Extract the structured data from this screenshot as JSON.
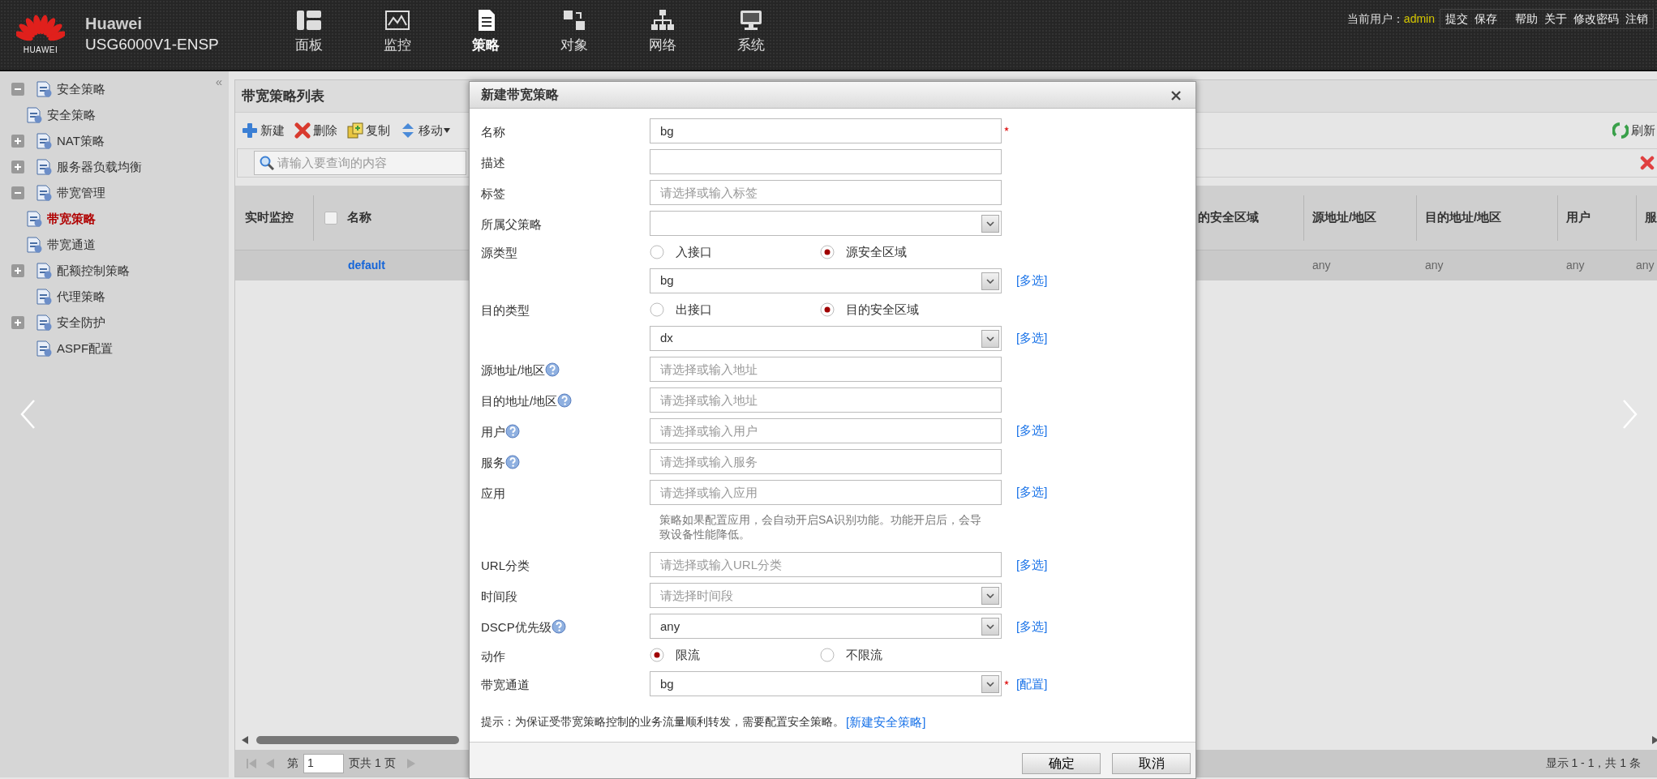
{
  "header": {
    "brand": {
      "logo_text": "HUAWEI",
      "name": "Huawei",
      "model": "USG6000V1-ENSP"
    },
    "nav": [
      {
        "label": "面板",
        "selected": false
      },
      {
        "label": "监控",
        "selected": false
      },
      {
        "label": "策略",
        "selected": true
      },
      {
        "label": "对象",
        "selected": false
      },
      {
        "label": "网络",
        "selected": false
      },
      {
        "label": "系统",
        "selected": false
      }
    ],
    "user_label": "当前用户：",
    "user": "admin",
    "action_groups": [
      [
        "提交",
        "保存"
      ],
      [
        "帮助",
        "关于",
        "修改密码",
        "注销"
      ]
    ]
  },
  "sidebar": {
    "collapse": "«",
    "items": [
      {
        "label": "安全策略",
        "expanded": true,
        "selected": false,
        "children": [
          {
            "label": "安全策略",
            "selected": false
          }
        ]
      },
      {
        "label": "NAT策略",
        "expanded": false,
        "selected": false
      },
      {
        "label": "服务器负载均衡",
        "expanded": false,
        "selected": false
      },
      {
        "label": "带宽管理",
        "expanded": true,
        "selected": false,
        "children": [
          {
            "label": "带宽策略",
            "selected": true
          },
          {
            "label": "带宽通道",
            "selected": false
          }
        ]
      },
      {
        "label": "配额控制策略",
        "expanded": false,
        "selected": false
      },
      {
        "label": "代理策略",
        "selected": false
      },
      {
        "label": "安全防护",
        "expanded": false,
        "selected": false
      },
      {
        "label": "ASPF配置",
        "selected": false
      }
    ]
  },
  "panel": {
    "title": "带宽策略列表",
    "toolbar": [
      {
        "kind": "add",
        "label": "新建"
      },
      {
        "kind": "delete",
        "label": "删除"
      },
      {
        "kind": "copy",
        "label": "复制"
      },
      {
        "kind": "move",
        "label": "移动"
      }
    ],
    "refresh": "刷新",
    "search": {
      "placeholder": "请输入要查询的内容"
    },
    "table": {
      "select_all_checked": false,
      "columns": [
        "实时监控",
        "名称",
        "的安全区域",
        "源地址/地区",
        "目的地址/地区",
        "用户",
        "服"
      ],
      "rows": [
        {
          "cells": [
            "",
            "default",
            "",
            "any",
            "any",
            "any",
            "any"
          ]
        }
      ]
    },
    "pager": {
      "page_prefix": "第",
      "page": "1",
      "page_suffix": "页共 1 页",
      "summary": "显示 1 - 1，共 1 条"
    }
  },
  "dialog": {
    "title": "新建带宽策略",
    "fields": [
      {
        "kind": "input",
        "label": "名称",
        "value": "bg",
        "required": true
      },
      {
        "kind": "input",
        "label": "描述"
      },
      {
        "kind": "input",
        "label": "标签",
        "placeholder": "请选择或输入标签"
      },
      {
        "kind": "select",
        "label": "所属父策略"
      },
      {
        "kind": "radio",
        "label": "源类型",
        "options": [
          {
            "label": "入接口",
            "selected": false
          },
          {
            "label": "源安全区域",
            "selected": true
          }
        ]
      },
      {
        "kind": "select",
        "value": "bg",
        "link": "[多选]"
      },
      {
        "kind": "radio",
        "label": "目的类型",
        "options": [
          {
            "label": "出接口",
            "selected": false
          },
          {
            "label": "目的安全区域",
            "selected": true
          }
        ]
      },
      {
        "kind": "select",
        "value": "dx",
        "link": "[多选]"
      },
      {
        "kind": "input",
        "label": "源地址/地区",
        "help": true,
        "placeholder": "请选择或输入地址"
      },
      {
        "kind": "input",
        "label": "目的地址/地区",
        "help": true,
        "placeholder": "请选择或输入地址"
      },
      {
        "kind": "input",
        "label": "用户",
        "help": true,
        "placeholder": "请选择或输入用户",
        "link": "[多选]"
      },
      {
        "kind": "input",
        "label": "服务",
        "help": true,
        "placeholder": "请选择或输入服务"
      },
      {
        "kind": "input",
        "label": "应用",
        "placeholder": "请选择或输入应用",
        "link": "[多选]"
      },
      {
        "kind": "note",
        "text": "策略如果配置应用，会自动开启SA识别功能。功能开启后，会导致设备性能降低。"
      },
      {
        "kind": "input",
        "label": "URL分类",
        "placeholder": "请选择或输入URL分类",
        "link": "[多选]"
      },
      {
        "kind": "select",
        "label": "时间段",
        "placeholder": "请选择时间段"
      },
      {
        "kind": "select",
        "label": "DSCP优先级",
        "help": true,
        "value": "any",
        "link": "[多选]"
      },
      {
        "kind": "radio",
        "label": "动作",
        "options": [
          {
            "label": "限流",
            "selected": true
          },
          {
            "label": "不限流",
            "selected": false
          }
        ]
      },
      {
        "kind": "select",
        "label": "带宽通道",
        "value": "bg",
        "required": true,
        "link": "[配置]"
      }
    ],
    "hint": {
      "text": "提示：为保证受带宽策略控制的业务流量顺利转发，需要配置安全策略。",
      "link": "[新建安全策略]"
    },
    "buttons": [
      "确定",
      "取消"
    ]
  }
}
